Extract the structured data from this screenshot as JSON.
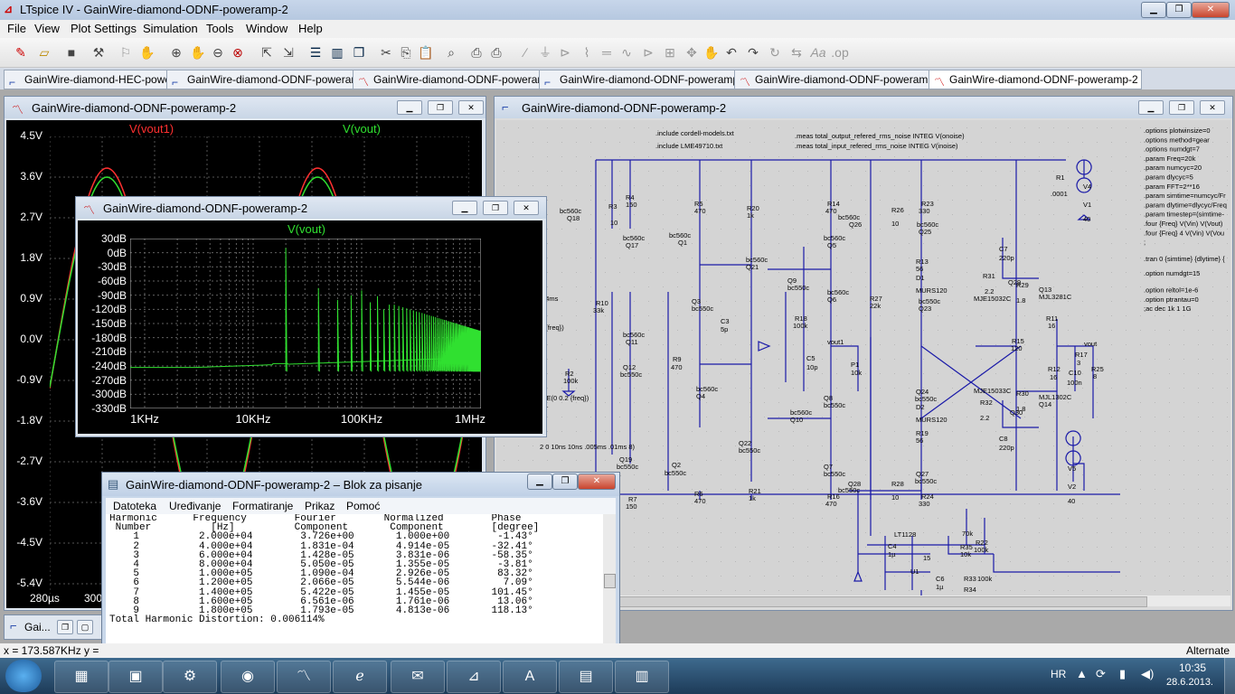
{
  "app": {
    "title": "LTspice IV - GainWire-diamond-ODNF-poweramp-2",
    "menu": [
      "File",
      "View",
      "Plot Settings",
      "Simulation",
      "Tools",
      "Window",
      "Help"
    ]
  },
  "toolbar_icons": [
    "new-schematic-icon",
    "open-icon",
    "save-icon",
    "control-panel-icon",
    "run-icon",
    "halt-icon",
    "zoom-in-icon",
    "pan-icon",
    "zoom-out-icon",
    "zoom-cancel-icon",
    "autorange-icon",
    "zoom-full-icon",
    "tile-horizontal-icon",
    "tile-vertical-icon",
    "cascade-icon",
    "cut-icon",
    "copy-icon",
    "paste-icon",
    "find-icon",
    "print-icon",
    "print-setup-icon",
    "wire-icon",
    "ground-icon",
    "label-icon",
    "resistor-icon",
    "capacitor-icon",
    "inductor-icon",
    "diode-icon",
    "component-icon",
    "move-icon",
    "drag-icon",
    "undo-icon",
    "redo-icon",
    "rotate-icon",
    "mirror-icon",
    "text-icon",
    "spice-directive-icon"
  ],
  "tabs": [
    {
      "label": "GainWire-diamond-HEC-power",
      "kind": "schematic"
    },
    {
      "label": "GainWire-diamond-ODNF-poweramp",
      "kind": "schematic"
    },
    {
      "label": "GainWire-diamond-ODNF-poweramp",
      "kind": "plot"
    },
    {
      "label": "GainWire-diamond-ODNF-poweramp-2",
      "kind": "schematic"
    },
    {
      "label": "GainWire-diamond-ODNF-poweramp-2",
      "kind": "plot"
    },
    {
      "label": "GainWire-diamond-ODNF-poweramp-2",
      "kind": "plot",
      "active": true
    }
  ],
  "transient_window": {
    "title": "GainWire-diamond-ODNF-poweramp-2",
    "traces": [
      {
        "name": "V(vout1)",
        "color": "#ff3030"
      },
      {
        "name": "V(vout)",
        "color": "#30e030"
      }
    ],
    "y_ticks": [
      "4.5V",
      "3.6V",
      "2.7V",
      "1.8V",
      "0.9V",
      "0.0V",
      "-0.9V",
      "-1.8V",
      "-2.7V",
      "-3.6V",
      "-4.5V",
      "-5.4V"
    ],
    "x_ticks": [
      "280µs",
      "300"
    ]
  },
  "fft_window": {
    "title": "GainWire-diamond-ODNF-poweramp-2",
    "trace": "V(vout)",
    "trace_color": "#30e030",
    "y_ticks": [
      "30dB",
      "0dB",
      "-30dB",
      "-60dB",
      "-90dB",
      "-120dB",
      "-150dB",
      "-180dB",
      "-210dB",
      "-240dB",
      "-270dB",
      "-300dB",
      "-330dB"
    ],
    "x_ticks": [
      "1KHz",
      "10KHz",
      "100KHz",
      "1MHz"
    ]
  },
  "schematic_window": {
    "title": "GainWire-diamond-ODNF-poweramp-2",
    "directives": [
      ".include cordell-models.txt",
      ".include LME49710.txt",
      ".meas total_output_refered_rms_noise INTEG V(onoise)",
      ".meas total_input_refered_rms_noise INTEG V(inoise)"
    ],
    "options": [
      ".options plotwinsize=0",
      ".options method=gear",
      ".options numdgt=7",
      ".param Freq=20k",
      ".param numcyc=20",
      ".param dlycyc=5",
      ".param FFT=2**16",
      ".param simtime=numcyc/Fr",
      ".param dlytime=dlycyc/Freq",
      ".param timestep=(simtime-",
      ".four {Freq} V(Vin) V(Vout)",
      ".four {Freq} 4 V(Vin) V(Vou",
      ";",
      ".tran 0 {simtime} {dlytime} {",
      ".option numdgt=15",
      ".option reltol=1e-6",
      ".option ptrantau=0",
      ";ac dec 1k 1 1G"
    ],
    "labels": [
      {
        "t": "bc560c",
        "x": 70,
        "y": 103
      },
      {
        "t": "Q18",
        "x": 78,
        "y": 111
      },
      {
        "t": "R3",
        "x": 124,
        "y": 98
      },
      {
        "t": "10",
        "x": 126,
        "y": 116
      },
      {
        "t": "R4",
        "x": 143,
        "y": 88
      },
      {
        "t": "150",
        "x": 143,
        "y": 96
      },
      {
        "t": "bc560c",
        "x": 140,
        "y": 133
      },
      {
        "t": "Q17",
        "x": 143,
        "y": 141
      },
      {
        "t": "R5",
        "x": 219,
        "y": 95
      },
      {
        "t": "470",
        "x": 219,
        "y": 103
      },
      {
        "t": "bc560c",
        "x": 191,
        "y": 130
      },
      {
        "t": "Q1",
        "x": 201,
        "y": 138
      },
      {
        "t": "R20",
        "x": 277,
        "y": 100
      },
      {
        "t": "1k",
        "x": 277,
        "y": 108
      },
      {
        "t": "bc560c",
        "x": 276,
        "y": 157
      },
      {
        "t": "Q21",
        "x": 276,
        "y": 165
      },
      {
        "t": "R14",
        "x": 366,
        "y": 95
      },
      {
        "t": "470",
        "x": 364,
        "y": 103
      },
      {
        "t": "bc560c",
        "x": 362,
        "y": 133
      },
      {
        "t": "Q5",
        "x": 366,
        "y": 141
      },
      {
        "t": "bc560c",
        "x": 378,
        "y": 110
      },
      {
        "t": "Q26",
        "x": 390,
        "y": 118
      },
      {
        "t": "R26",
        "x": 437,
        "y": 102
      },
      {
        "t": "10",
        "x": 437,
        "y": 117
      },
      {
        "t": "R23",
        "x": 470,
        "y": 95
      },
      {
        "t": "330",
        "x": 467,
        "y": 103
      },
      {
        "t": "bc560c",
        "x": 465,
        "y": 118
      },
      {
        "t": "Q25",
        "x": 467,
        "y": 126
      },
      {
        "t": "R13",
        "x": 464,
        "y": 159
      },
      {
        "t": "56",
        "x": 464,
        "y": 167
      },
      {
        "t": "D1",
        "x": 464,
        "y": 177
      },
      {
        "t": "MURS120",
        "x": 464,
        "y": 191
      },
      {
        "t": "R27",
        "x": 413,
        "y": 200
      },
      {
        "t": "22k",
        "x": 413,
        "y": 208
      },
      {
        "t": "bc550c",
        "x": 467,
        "y": 203
      },
      {
        "t": "Q23",
        "x": 467,
        "y": 211
      },
      {
        "t": "C7",
        "x": 556,
        "y": 145
      },
      {
        "t": "220p",
        "x": 556,
        "y": 155
      },
      {
        "t": "R31",
        "x": 538,
        "y": 175
      },
      {
        "t": "2.2",
        "x": 540,
        "y": 192
      },
      {
        "t": "Q29",
        "x": 566,
        "y": 182
      },
      {
        "t": "MJE15032C",
        "x": 528,
        "y": 200
      },
      {
        "t": "R29",
        "x": 575,
        "y": 185
      },
      {
        "t": "1.8",
        "x": 575,
        "y": 202
      },
      {
        "t": "Q13",
        "x": 600,
        "y": 190
      },
      {
        "t": "MJL3281C",
        "x": 600,
        "y": 198
      },
      {
        "t": "R11",
        "x": 608,
        "y": 222
      },
      {
        "t": "16",
        "x": 610,
        "y": 230
      },
      {
        "t": "R1",
        "x": 619,
        "y": 66
      },
      {
        "t": ".0001",
        "x": 613,
        "y": 84
      },
      {
        "t": "V4",
        "x": 649,
        "y": 76
      },
      {
        "t": "V1",
        "x": 649,
        "y": 96
      },
      {
        "t": "40",
        "x": 649,
        "y": 112
      },
      {
        "t": "R10",
        "x": 110,
        "y": 205
      },
      {
        "t": "33k",
        "x": 107,
        "y": 213
      },
      {
        "t": "Q3",
        "x": 216,
        "y": 203
      },
      {
        "t": "bc550c",
        "x": 216,
        "y": 211
      },
      {
        "t": "C3",
        "x": 248,
        "y": 225
      },
      {
        "t": "5p",
        "x": 248,
        "y": 234
      },
      {
        "t": "R18",
        "x": 330,
        "y": 222
      },
      {
        "t": "100k",
        "x": 328,
        "y": 230
      },
      {
        "t": "Q9",
        "x": 322,
        "y": 180
      },
      {
        "t": "bc550c",
        "x": 322,
        "y": 188
      },
      {
        "t": "bc560c",
        "x": 366,
        "y": 193
      },
      {
        "t": "Q6",
        "x": 366,
        "y": 201
      },
      {
        "t": "vout1",
        "x": 366,
        "y": 248
      },
      {
        "t": "C5",
        "x": 343,
        "y": 266
      },
      {
        "t": "10p",
        "x": 343,
        "y": 276
      },
      {
        "t": "P1",
        "x": 392,
        "y": 273
      },
      {
        "t": "10k",
        "x": 392,
        "y": 282
      },
      {
        "t": "R15",
        "x": 570,
        "y": 247
      },
      {
        "t": "120",
        "x": 569,
        "y": 255
      },
      {
        "t": "R12",
        "x": 610,
        "y": 278
      },
      {
        "t": "16",
        "x": 612,
        "y": 287
      },
      {
        "t": "vout",
        "x": 650,
        "y": 250
      },
      {
        "t": "R17",
        "x": 640,
        "y": 262
      },
      {
        "t": "3",
        "x": 642,
        "y": 271
      },
      {
        "t": "C10",
        "x": 633,
        "y": 282
      },
      {
        "t": "100n",
        "x": 631,
        "y": 293
      },
      {
        "t": "R25",
        "x": 658,
        "y": 278
      },
      {
        "t": "8",
        "x": 660,
        "y": 286
      },
      {
        "t": "bc560c",
        "x": 140,
        "y": 240
      },
      {
        "t": "Q11",
        "x": 143,
        "y": 248
      },
      {
        "t": "Q12",
        "x": 140,
        "y": 276
      },
      {
        "t": "bc550c",
        "x": 137,
        "y": 284
      },
      {
        "t": "R9",
        "x": 195,
        "y": 267
      },
      {
        "t": "470",
        "x": 193,
        "y": 276
      },
      {
        "t": "bc560c",
        "x": 221,
        "y": 300
      },
      {
        "t": "Q4",
        "x": 221,
        "y": 308
      },
      {
        "t": "Q8",
        "x": 362,
        "y": 310
      },
      {
        "t": "bc550c",
        "x": 362,
        "y": 318
      },
      {
        "t": "bc560c",
        "x": 325,
        "y": 326
      },
      {
        "t": "Q10",
        "x": 325,
        "y": 334
      },
      {
        "t": "Q24",
        "x": 464,
        "y": 303
      },
      {
        "t": "bc550c",
        "x": 463,
        "y": 311
      },
      {
        "t": "D2",
        "x": 464,
        "y": 320
      },
      {
        "t": "MURS120",
        "x": 464,
        "y": 334
      },
      {
        "t": "R19",
        "x": 464,
        "y": 349
      },
      {
        "t": "56",
        "x": 464,
        "y": 357
      },
      {
        "t": "MJE15033C",
        "x": 528,
        "y": 302
      },
      {
        "t": "R32",
        "x": 535,
        "y": 315
      },
      {
        "t": "2.2",
        "x": 535,
        "y": 332
      },
      {
        "t": "R30",
        "x": 575,
        "y": 305
      },
      {
        "t": "1.8",
        "x": 575,
        "y": 322
      },
      {
        "t": "Q30",
        "x": 568,
        "y": 326
      },
      {
        "t": "MJL1302C",
        "x": 600,
        "y": 309
      },
      {
        "t": "Q14",
        "x": 600,
        "y": 317
      },
      {
        "t": "C8",
        "x": 556,
        "y": 355
      },
      {
        "t": "220p",
        "x": 556,
        "y": 365
      },
      {
        "t": "Q22",
        "x": 268,
        "y": 360
      },
      {
        "t": "bc550c",
        "x": 268,
        "y": 368
      },
      {
        "t": "Q19",
        "x": 136,
        "y": 378
      },
      {
        "t": "bc550c",
        "x": 133,
        "y": 386
      },
      {
        "t": "R8",
        "x": 128,
        "y": 395
      },
      {
        "t": "10",
        "x": 128,
        "y": 413
      },
      {
        "t": "bc550c",
        "x": 186,
        "y": 393
      },
      {
        "t": "Q2",
        "x": 194,
        "y": 384
      },
      {
        "t": "R6",
        "x": 219,
        "y": 416
      },
      {
        "t": "470",
        "x": 219,
        "y": 424
      },
      {
        "t": "R21",
        "x": 279,
        "y": 413
      },
      {
        "t": "1k",
        "x": 279,
        "y": 421
      },
      {
        "t": "Q7",
        "x": 362,
        "y": 386
      },
      {
        "t": "bc550c",
        "x": 362,
        "y": 394
      },
      {
        "t": "R16",
        "x": 366,
        "y": 419
      },
      {
        "t": "470",
        "x": 364,
        "y": 427
      },
      {
        "t": "Q27",
        "x": 464,
        "y": 394
      },
      {
        "t": "bc550c",
        "x": 463,
        "y": 402
      },
      {
        "t": "bc550c",
        "x": 378,
        "y": 412
      },
      {
        "t": "Q28",
        "x": 389,
        "y": 405
      },
      {
        "t": "R28",
        "x": 437,
        "y": 405
      },
      {
        "t": "10",
        "x": 437,
        "y": 420
      },
      {
        "t": "R24",
        "x": 470,
        "y": 419
      },
      {
        "t": "330",
        "x": 467,
        "y": 427
      },
      {
        "t": "Q20",
        "x": 90,
        "y": 400
      },
      {
        "t": "bc550c",
        "x": 80,
        "y": 408
      },
      {
        "t": "R7",
        "x": 146,
        "y": 422
      },
      {
        "t": "150",
        "x": 143,
        "y": 430
      },
      {
        "t": "V5",
        "x": 632,
        "y": 388
      },
      {
        "t": "V2",
        "x": 632,
        "y": 408
      },
      {
        "t": "40",
        "x": 632,
        "y": 424
      },
      {
        "t": "LT1128",
        "x": 440,
        "y": 461
      },
      {
        "t": "C4",
        "x": 433,
        "y": 474
      },
      {
        "t": "1µ",
        "x": 433,
        "y": 483
      },
      {
        "t": "15",
        "x": 472,
        "y": 487
      },
      {
        "t": "70k",
        "x": 515,
        "y": 460
      },
      {
        "t": "R35",
        "x": 513,
        "y": 475
      },
      {
        "t": "10k",
        "x": 513,
        "y": 483
      },
      {
        "t": "R22",
        "x": 530,
        "y": 470
      },
      {
        "t": "100k",
        "x": 528,
        "y": 478
      },
      {
        "t": "U1",
        "x": 458,
        "y": 502
      },
      {
        "t": "C6",
        "x": 486,
        "y": 510
      },
      {
        "t": "1µ",
        "x": 486,
        "y": 519
      },
      {
        "t": "R33",
        "x": 517,
        "y": 510
      },
      {
        "t": "100k",
        "x": 532,
        "y": 510
      },
      {
        "t": "R34",
        "x": 517,
        "y": 522
      },
      {
        "t": "10k",
        "x": 517,
        "y": 533
      },
      {
        "t": "R37",
        "x": 446,
        "y": 548
      },
      {
        "t": "100k",
        "x": 466,
        "y": 548
      },
      {
        "t": ".04ms",
        "x": 48,
        "y": 200
      },
      {
        "t": "2 {freq})",
        "x": 48,
        "y": 232
      },
      {
        "t": "3",
        "x": 48,
        "y": 292
      },
      {
        "t": "R2",
        "x": 76,
        "y": 283
      },
      {
        "t": "100k",
        "x": 74,
        "y": 291
      },
      {
        "t": "INE(0 0.2 {freq})",
        "x": 48,
        "y": 310
      },
      {
        "t": "C1",
        "x": 48,
        "y": 318
      },
      {
        "t": "2 0 10ns 10ns .005ms .01ms 8)",
        "x": 48,
        "y": 364
      }
    ]
  },
  "notepad": {
    "title": "GainWire-diamond-ODNF-poweramp-2 – Blok za pisanje",
    "menu": [
      "Datoteka",
      "Uređivanje",
      "Formatiranje",
      "Prikaz",
      "Pomoć"
    ],
    "header1": "Harmonic      Frequency        Fourier        Normalized        Phase",
    "header2": " Number          [Hz]          Component       Component        [degree]",
    "rows": [
      [
        "1",
        "2.000e+04",
        "3.726e+00",
        "1.000e+00",
        "-1.43°"
      ],
      [
        "2",
        "4.000e+04",
        "1.831e-04",
        "4.914e-05",
        "-32.41°"
      ],
      [
        "3",
        "6.000e+04",
        "1.428e-05",
        "3.831e-06",
        "-58.35°"
      ],
      [
        "4",
        "8.000e+04",
        "5.050e-05",
        "1.355e-05",
        "-3.81°"
      ],
      [
        "5",
        "1.000e+05",
        "1.090e-04",
        "2.926e-05",
        "83.32°"
      ],
      [
        "6",
        "1.200e+05",
        "2.066e-05",
        "5.544e-06",
        "7.09°"
      ],
      [
        "7",
        "1.400e+05",
        "5.422e-05",
        "1.455e-05",
        "101.45°"
      ],
      [
        "8",
        "1.600e+05",
        "6.561e-06",
        "1.761e-06",
        "13.06°"
      ],
      [
        "9",
        "1.800e+05",
        "1.793e-05",
        "4.813e-06",
        "118.13°"
      ]
    ],
    "thd": "Total Harmonic Distortion: 0.006114%"
  },
  "minimized_window": {
    "label": "Gai..."
  },
  "status": {
    "left": "x = 173.587KHz   y =",
    "right": "Alternate"
  },
  "taskbar": {
    "items": [
      "windows-explorer",
      "media-player",
      "app-gear",
      "antivirus",
      "ltspice-scope",
      "internet-explorer",
      "outlook",
      "ltspice",
      "word",
      "notepad",
      "archive"
    ],
    "lang": "HR",
    "time": "10:35",
    "date": "28.6.2013."
  }
}
